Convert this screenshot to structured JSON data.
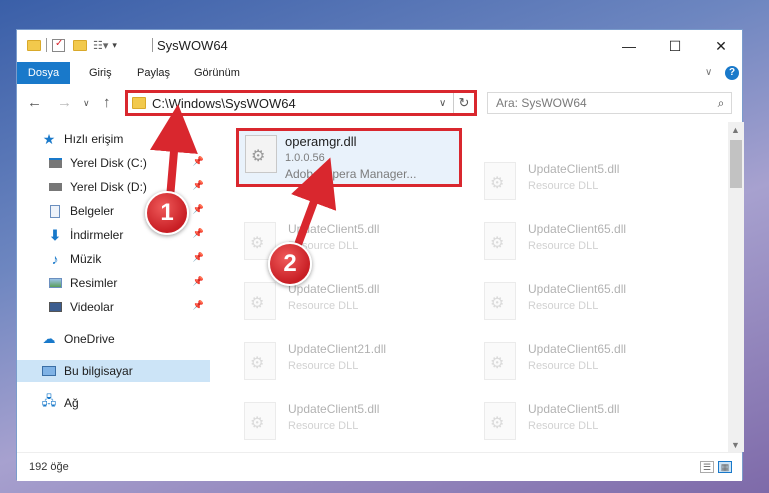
{
  "window": {
    "title": "SysWOW64",
    "controls": {
      "minimize": "—",
      "maximize": "☐",
      "close": "✕"
    },
    "help_icon": "?"
  },
  "ribbon": {
    "tabs": [
      "Dosya",
      "Giriş",
      "Paylaş",
      "Görünüm"
    ],
    "expand_icon": "chevron-down-icon"
  },
  "address": {
    "path": "C:\\Windows\\SysWOW64",
    "search_placeholder": "Ara: SysWOW64"
  },
  "nav": {
    "quick_access": "Hızlı erişim",
    "items": [
      {
        "label": "Yerel Disk (C:)",
        "icon": "drive-icon",
        "pinned": true
      },
      {
        "label": "Yerel Disk (D:)",
        "icon": "drive-icon",
        "pinned": true
      },
      {
        "label": "Belgeler",
        "icon": "documents-icon",
        "pinned": true
      },
      {
        "label": "İndirmeler",
        "icon": "downloads-icon",
        "pinned": true
      },
      {
        "label": "Müzik",
        "icon": "music-icon",
        "pinned": true
      },
      {
        "label": "Resimler",
        "icon": "pictures-icon",
        "pinned": true
      },
      {
        "label": "Videolar",
        "icon": "videos-icon",
        "pinned": true
      }
    ],
    "onedrive": "OneDrive",
    "this_pc": "Bu bilgisayar",
    "network": "Ağ"
  },
  "files": {
    "highlighted": {
      "name": "operamgr.dll",
      "version": "1.0.0.56",
      "description": "Adobe Opera Manager..."
    },
    "left_column": [
      {
        "name": "UpdateClient5.dll",
        "description": "Resource DLL"
      },
      {
        "name": "UpdateClient5.dll",
        "description": "Resource DLL"
      },
      {
        "name": "UpdateClient21.dll",
        "description": "Resource DLL"
      },
      {
        "name": "UpdateClient5.dll",
        "description": "Resource DLL"
      }
    ],
    "right_column": [
      {
        "name": "UpdateClient5.dll",
        "description": "Resource DLL"
      },
      {
        "name": "UpdateClient65.dll",
        "description": "Resource DLL"
      },
      {
        "name": "UpdateClient65.dll",
        "description": "Resource DLL"
      },
      {
        "name": "UpdateClient65.dll",
        "description": "Resource DLL"
      },
      {
        "name": "UpdateClient5.dll",
        "description": "Resource DLL"
      }
    ]
  },
  "status": {
    "item_count": "192 öğe"
  },
  "annotations": {
    "step1": "1",
    "step2": "2",
    "color": "#d9272e"
  }
}
